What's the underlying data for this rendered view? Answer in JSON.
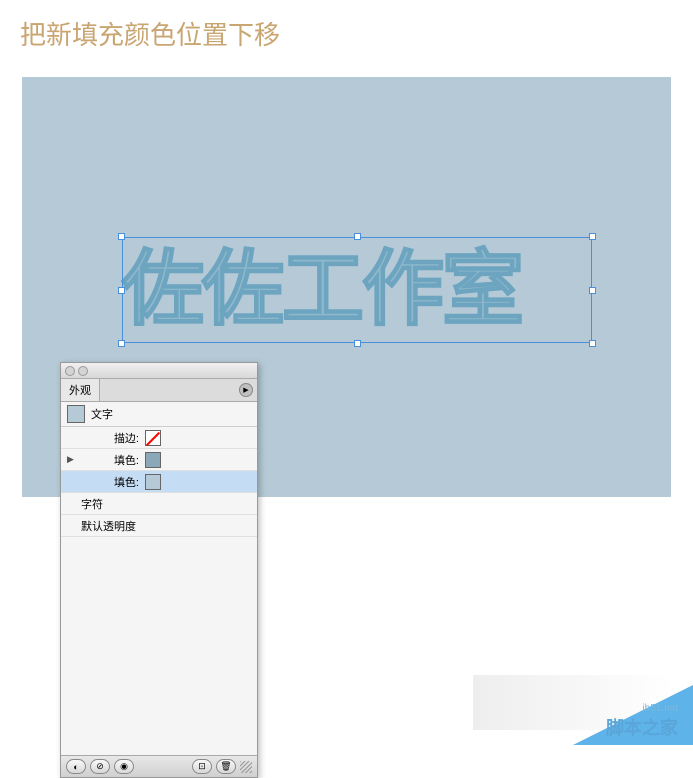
{
  "page_title": "把新填充颜色位置下移",
  "canvas": {
    "bg_color": "#b5cad6",
    "artwork_text": "佐佐工作室"
  },
  "panel": {
    "tab_label": "外观",
    "type_label": "文字",
    "rows": {
      "stroke_label": "描边:",
      "fill1_label": "填色:",
      "fill2_label": "填色:",
      "char_label": "字符",
      "opacity_label": "默认透明度"
    }
  },
  "watermark": {
    "url": "jb51.net",
    "text": "脚本之家"
  },
  "colors": {
    "canvas_bg": "#b5cad6",
    "text_fill": "#8fb8cb",
    "text_stroke": "#6da5c1",
    "title": "#c9a572",
    "selection": "#4a90d9"
  }
}
